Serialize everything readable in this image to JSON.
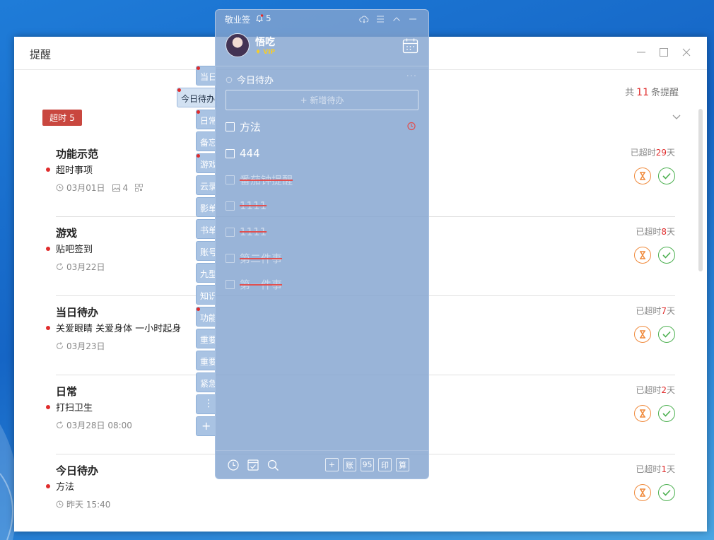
{
  "window": {
    "title": "提醒"
  },
  "summary": {
    "prefix": "共",
    "count": "11",
    "suffix": "条提醒"
  },
  "overdue_tag": {
    "label": "超时",
    "count": "5"
  },
  "tasks": [
    {
      "title": "功能示范",
      "subtitle": "超时事项",
      "date": "03月01日",
      "image_count": "4",
      "status_prefix": "已超时",
      "days": "29",
      "status_suffix": "天"
    },
    {
      "title": "游戏",
      "subtitle": "贴吧签到",
      "date": "03月22日",
      "status_prefix": "已超时",
      "days": "8",
      "status_suffix": "天"
    },
    {
      "title": "当日待办",
      "subtitle": "关爱眼睛 关爱身体 一小时起身",
      "date": "03月23日",
      "status_prefix": "已超时",
      "days": "7",
      "status_suffix": "天"
    },
    {
      "title": "日常",
      "subtitle": "打扫卫生",
      "date": "03月28日 08:00",
      "status_prefix": "已超时",
      "days": "2",
      "status_suffix": "天"
    },
    {
      "title": "今日待办",
      "subtitle": "方法",
      "date": "昨天 15:40",
      "status_prefix": "已超时",
      "days": "1",
      "status_suffix": "天"
    }
  ],
  "side_tabs": [
    "当日",
    "今日待办",
    "日常",
    "备忘",
    "游戏",
    "云录",
    "影单",
    "书单",
    "账号",
    "九型",
    "知识",
    "功能",
    "重要",
    "重要",
    "紧急"
  ],
  "side_more": "⋮",
  "side_add": "+",
  "panel": {
    "app_name": "敬业签",
    "notify_count": "5",
    "user": {
      "name": "悟吃",
      "badge": "VIP"
    },
    "section": "今日待办",
    "section_more": "···",
    "add_label": "+ 新增待办",
    "items": [
      {
        "label": "方法",
        "done": false
      },
      {
        "label": "444",
        "done": false
      },
      {
        "label": "番茄钟提醒",
        "done": true
      },
      {
        "label": "1111",
        "done": true
      },
      {
        "label": "1111",
        "done": true
      },
      {
        "label": "第二件事",
        "done": true
      },
      {
        "label": "第一件事",
        "done": true
      }
    ],
    "bottom_buttons": [
      "+",
      "账",
      "95",
      "印",
      "算"
    ]
  },
  "colors": {
    "accent_red": "#e02c2c",
    "overdue_bg": "#c9473f",
    "panel_bg": "#82a3d0",
    "snooze": "#f08a3c",
    "complete": "#4cb050"
  }
}
